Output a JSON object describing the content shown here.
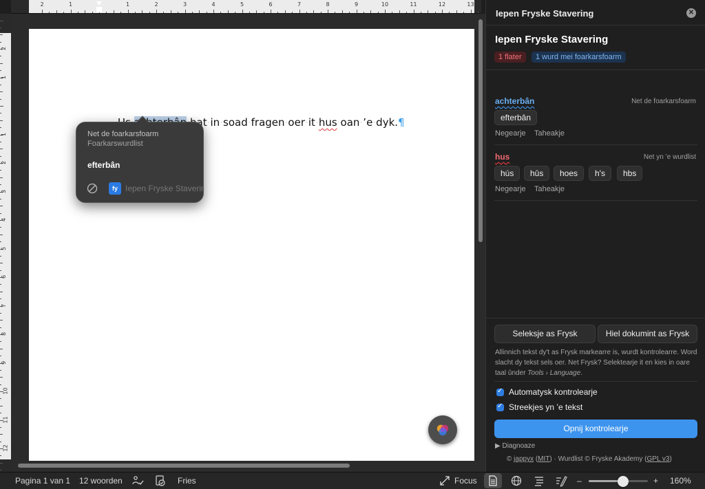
{
  "ruler": {
    "h_numbers": [
      "2",
      "1",
      "",
      "1",
      "2",
      "3",
      "4",
      "5",
      "6",
      "7",
      "8",
      "9",
      "10",
      "11",
      "12",
      "13"
    ],
    "v_numbers": [
      "2",
      "1",
      "",
      "1",
      "2",
      "3",
      "4",
      "5",
      "6",
      "7",
      "8",
      "9",
      "10",
      "11",
      "12",
      "13",
      "14"
    ]
  },
  "document": {
    "words": [
      "Us",
      "achterbân",
      "hat",
      "in",
      "soad",
      "fragen",
      "oer",
      "it",
      "hus",
      "oan",
      "’e",
      "dyk."
    ],
    "selected_part1": "achter",
    "selected_part2": "bân",
    "error_word": "hus",
    "pilcrow": "¶"
  },
  "popup": {
    "title": "Net de foarkarsfoarm",
    "subtitle": "Foarkarswurdlist",
    "suggestion": "efterbân",
    "app_badge": "fy",
    "app_name": "Iepen Fryske Stavering"
  },
  "statusbar": {
    "page": "Pagina 1 van 1",
    "words": "12 woorden",
    "language": "Fries",
    "focus": "Focus",
    "zoom": "160%",
    "zoom_level": 0.58,
    "minus": "–",
    "plus": "+"
  },
  "panel": {
    "header": "Iepen Fryske Stavering",
    "title": "Iepen Fryske Stavering",
    "badge_errors": "1 flater",
    "badge_pref": "1 wurd mei foarkarsfoarm",
    "issue1": {
      "word": "achterbân",
      "note": "Net de foarkarsfoarm",
      "suggestions": [
        "efterbân"
      ],
      "ignore": "Negearje",
      "add": "Taheakje"
    },
    "issue2": {
      "word": "hus",
      "note": "Net yn ’e wurdlist",
      "suggestions": [
        "hús",
        "hûs",
        "hoes",
        "h's",
        "hbs"
      ],
      "ignore": "Negearje",
      "add": "Taheakje"
    },
    "btn_selection": "Seleksje as Frysk",
    "btn_document": "Hiel dokumint as Frysk",
    "help_text": "Allinnich tekst dy't as Frysk markearre is, wurdt kontrolearre. Word slacht dy tekst sels oer. Net Frysk? Selektearje it en kies in oare taal ûnder ",
    "help_menu": "Tools › Language",
    "help_end": ".",
    "check_auto": "Automatysk kontrolearje",
    "check_underline": "Streekjes yn ’e tekst",
    "recheck": "Opnij kontrolearje",
    "diagnose": "▶ Diagnoaze",
    "credit_pre": "© ",
    "credit_author": "jappyx",
    "credit_mid1": " (",
    "credit_license1": "MIT",
    "credit_mid2": ") · Wurdlist © Fryske Akademy (",
    "credit_license2": "GPL v3",
    "credit_end": ")"
  },
  "colors": {
    "accent": "#3d94ee",
    "error": "#e0383e",
    "preferred": "#3d8ee0"
  }
}
